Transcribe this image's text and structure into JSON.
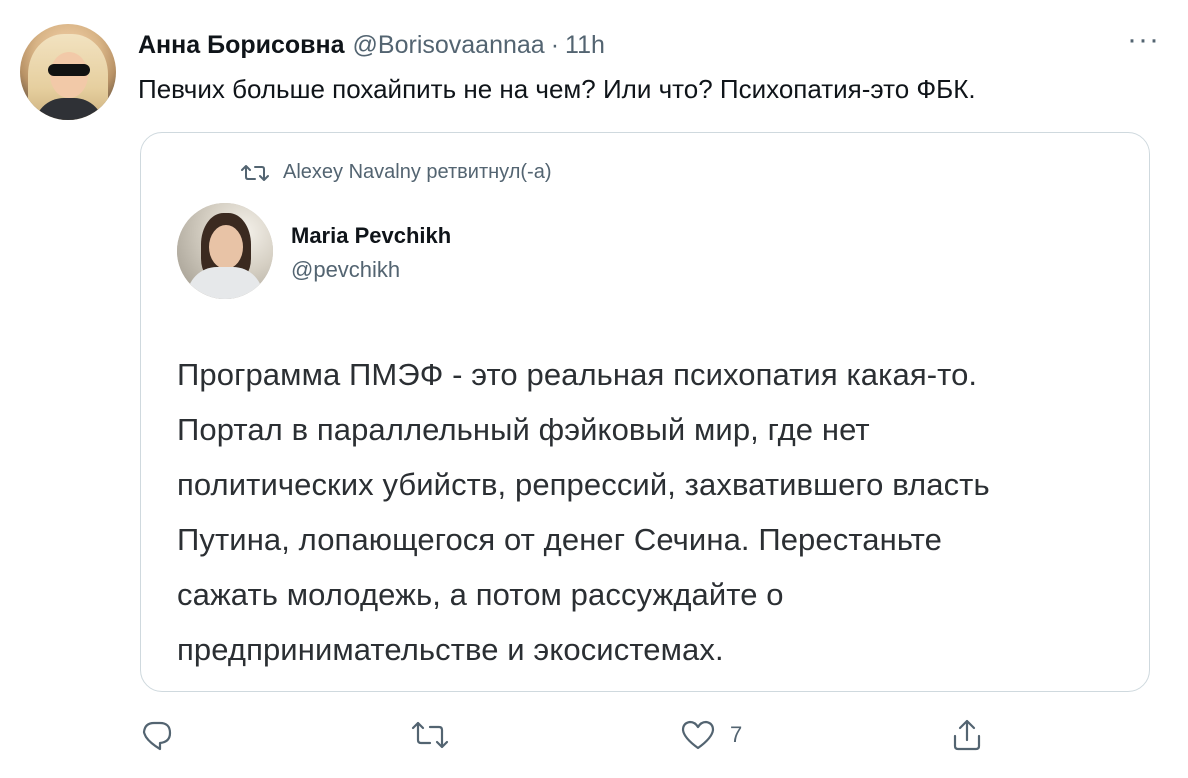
{
  "author": {
    "name": "Анна Борисовна",
    "handle": "@Borisovaannaa",
    "separator": "·",
    "time": "11h"
  },
  "more_label": "···",
  "tweet_text": "Певчих больше похайпить не на чем? Или что? Психопатия-это ФБК.",
  "quoted": {
    "retweet_line": "Alexey Navalny ретвитнул(-а)",
    "name": "Maria Pevchikh",
    "handle": "@pevchikh",
    "body_lines": [
      "Программа ПМЭФ - это реальная психопатия какая-то.",
      "Портал в параллельный фэйковый мир, где нет",
      "политических убийств, репрессий, захватившего власть",
      "Путина, лопающегося от денег Сечина. Перестаньте",
      "сажать молодежь, а потом рассуждайте о",
      "предпринимательстве и экосистемах."
    ]
  },
  "actions": {
    "reply_icon": "reply-icon",
    "retweet_icon": "retweet-icon",
    "like_icon": "heart-icon",
    "like_count": "7",
    "share_icon": "share-icon"
  },
  "colors": {
    "text": "#0f1419",
    "secondary": "#536471",
    "border": "#cfd9de"
  }
}
